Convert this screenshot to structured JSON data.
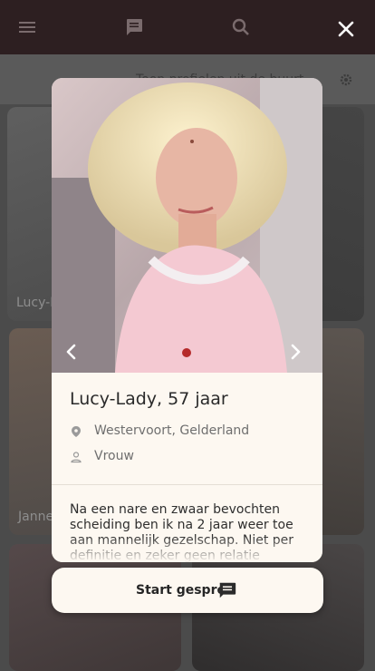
{
  "header": {
    "icons": [
      "menu-icon",
      "chat-icon",
      "search-icon"
    ],
    "close_icon": "close-icon"
  },
  "subbar": {
    "text": "Toon profielen uit de buurt",
    "icon": "settings-icon"
  },
  "grid": {
    "card_names": [
      "Lucy-Lady",
      "Janne"
    ]
  },
  "profile": {
    "title": "Lucy-Lady, 57 jaar",
    "location": "Westervoort, Gelderland",
    "gender": "Vrouw",
    "bio": "Na een nare en zwaar bevochten scheiding ben ik na 2 jaar weer toe aan mannelijk gezelschap. Niet per definitie en zeker geen relatie",
    "photo_count_active": 1
  },
  "cta": {
    "label": "Start gesprek"
  },
  "colors": {
    "accent": "#b52a2a",
    "topbar": "#2d1f21",
    "panel": "#fdf8f1"
  }
}
